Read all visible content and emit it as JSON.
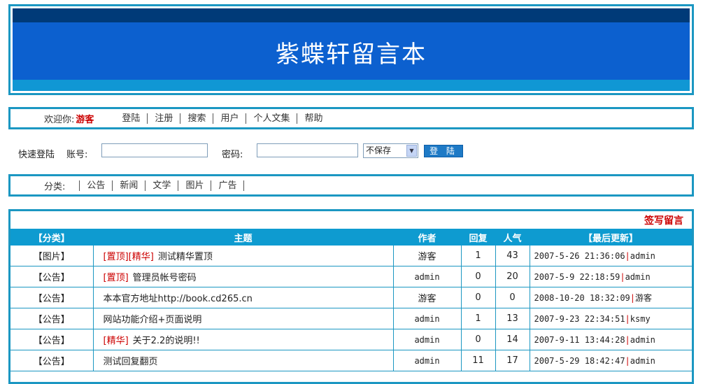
{
  "header": {
    "title": "紫蝶轩留言本"
  },
  "nav": {
    "welcome_label": "欢迎你:",
    "welcome_user": "游客",
    "links": [
      "登陆",
      "注册",
      "搜索",
      "用户",
      "个人文集",
      "帮助"
    ]
  },
  "login": {
    "quick_label": "快速登陆",
    "account_label": "账号:",
    "account_value": "",
    "password_label": "密码:",
    "password_value": "",
    "save_option": "不保存",
    "submit_label": "登 陆"
  },
  "categories": {
    "label": "分类:",
    "items": [
      "公告",
      "新闻",
      "文学",
      "图片",
      "广告"
    ]
  },
  "posts": {
    "sign_label": "签写留言",
    "columns": [
      "【分类】",
      "主题",
      "作者",
      "回复",
      "人气",
      "【最后更新】"
    ],
    "rows": [
      {
        "category": "【图片】",
        "tags": [
          "[置顶]",
          "[精华]"
        ],
        "subject": "测试精华置顶",
        "author": "游客",
        "replies": "1",
        "views": "43",
        "updated_time": "2007-5-26 21:36:06",
        "updated_by": "admin"
      },
      {
        "category": "【公告】",
        "tags": [
          "[置顶]"
        ],
        "subject": "管理员帐号密码",
        "author": "admin",
        "replies": "0",
        "views": "20",
        "updated_time": "2007-5-9 22:18:59",
        "updated_by": "admin"
      },
      {
        "category": "【公告】",
        "tags": [],
        "subject": "本本官方地址http://book.cd265.cn",
        "author": "游客",
        "replies": "0",
        "views": "0",
        "updated_time": "2008-10-20 18:32:09",
        "updated_by": "游客"
      },
      {
        "category": "【公告】",
        "tags": [],
        "subject": "网站功能介绍+页面说明",
        "author": "admin",
        "replies": "1",
        "views": "13",
        "updated_time": "2007-9-23 22:34:51",
        "updated_by": "ksmy"
      },
      {
        "category": "【公告】",
        "tags": [
          "[精华]"
        ],
        "subject": "关于2.2的说明!!",
        "author": "admin",
        "replies": "0",
        "views": "14",
        "updated_time": "2007-9-11 13:44:28",
        "updated_by": "admin"
      },
      {
        "category": "【公告】",
        "tags": [],
        "subject": "测试回复翻页",
        "author": "admin",
        "replies": "11",
        "views": "17",
        "updated_time": "2007-5-29 18:42:47",
        "updated_by": "admin"
      }
    ]
  }
}
